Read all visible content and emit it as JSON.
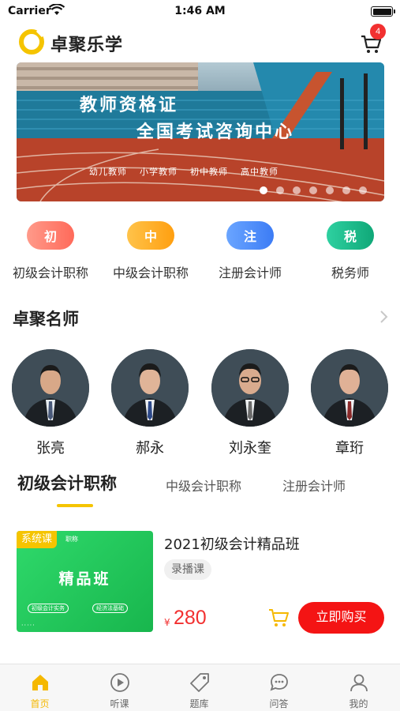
{
  "status_bar": {
    "carrier": "Carrier",
    "time": "1:46 AM"
  },
  "header": {
    "app_name": "卓聚乐学",
    "cart_count": "4"
  },
  "banner": {
    "title": "教师资格证",
    "subtitle": "全国考试咨询中心",
    "levels": [
      "幼儿教师",
      "小学教师",
      "初中教师",
      "高中教师"
    ],
    "page_count": 7,
    "active_page": 1
  },
  "categories": [
    {
      "char": "初",
      "label": "初级会计职称",
      "color": "#ff7a6b"
    },
    {
      "char": "中",
      "label": "中级会计职称",
      "color": "#ffad1f"
    },
    {
      "char": "注",
      "label": "注册会计师",
      "color": "#4d8dff"
    },
    {
      "char": "税",
      "label": "税务师",
      "color": "#18b88a"
    }
  ],
  "teachers_section": {
    "title": "卓聚名师"
  },
  "teachers": [
    {
      "name": "张亮"
    },
    {
      "name": "郝永"
    },
    {
      "name": "刘永奎"
    },
    {
      "name": "章珩"
    }
  ],
  "tabs": [
    "初级会计职称",
    "中级会计职称",
    "注册会计师"
  ],
  "course": {
    "thumb_tag": "系统课",
    "thumb_tag_small": "职称",
    "thumb_title": "精品班",
    "thumb_chips": [
      "初级会计实务",
      "经济法基础"
    ],
    "thumb_dots": "·····",
    "title": "2021初级会计精品班",
    "tag": "录播课",
    "currency": "¥",
    "price": "280",
    "buy_label": "立即购买"
  },
  "bottom_nav": [
    {
      "label": "首页",
      "icon": "home-icon",
      "active": true
    },
    {
      "label": "听课",
      "icon": "play-icon",
      "active": false
    },
    {
      "label": "题库",
      "icon": "tag-icon",
      "active": false
    },
    {
      "label": "问答",
      "icon": "chat-icon",
      "active": false
    },
    {
      "label": "我的",
      "icon": "user-icon",
      "active": false
    }
  ],
  "colors": {
    "accent": "#f5c400",
    "buy": "#f41414",
    "price": "#f23030"
  }
}
